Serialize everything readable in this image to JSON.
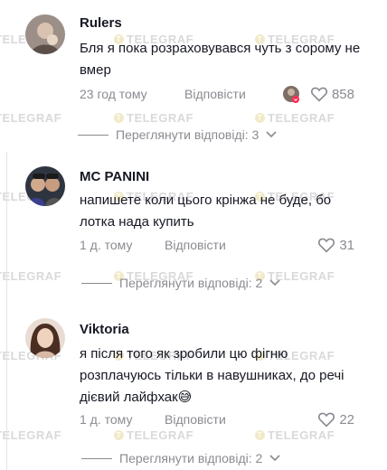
{
  "watermark": "TELEGRAF",
  "comments": [
    {
      "author": "Rulers",
      "text": "Бля я пока розраховувався чуть з сорому не вмер",
      "time": "23 год тому",
      "reply_label": "Відповісти",
      "likes": "858",
      "view_replies": "Переглянути відповіді: 3"
    },
    {
      "author": "MC PANINI",
      "text": "напишете коли цього крінжа не буде, бо лотка нада купить",
      "time": "1 д. тому",
      "reply_label": "Відповісти",
      "likes": "31",
      "view_replies": "Переглянути відповіді: 2"
    },
    {
      "author": "Viktoria",
      "text": "я після того як зробили цю фігню розплачуюсь тільки в навушниках, до речі дієвий лайфхак😅",
      "time": "1 д. тому",
      "reply_label": "Відповісти",
      "likes": "22",
      "view_replies": "Переглянути відповіді: 2"
    }
  ]
}
